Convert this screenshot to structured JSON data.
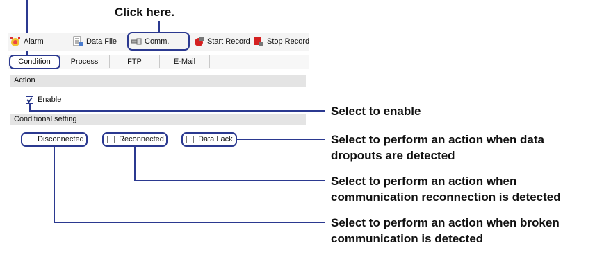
{
  "callout": {
    "click_here": "Click here."
  },
  "toolbar": {
    "alarm": "Alarm",
    "data_file": "Data File",
    "comm": "Comm.",
    "start_record": "Start Record",
    "stop_record": "Stop Record"
  },
  "tabs": [
    "Condition",
    "Process",
    "FTP",
    "E-Mail"
  ],
  "sections": {
    "action": "Action",
    "enable_label": "Enable",
    "conditional_setting": "Conditional setting"
  },
  "conditions": {
    "disconnected": "Disconnected",
    "reconnected": "Reconnected",
    "data_lack": "Data Lack"
  },
  "annotations": {
    "enable": "Select to enable",
    "data_lack_1": "Select to perform an action when data",
    "data_lack_2": "dropouts are detected",
    "reconnected_1": "Select to perform an action when",
    "reconnected_2": "communication reconnection is detected",
    "disconnected_1": "Select to perform an action when broken",
    "disconnected_2": "communication is detected"
  },
  "colors": {
    "callout_line": "#2b3990",
    "section_bg": "#e4e4e4",
    "toolbar_bg": "#f4f4f4"
  }
}
